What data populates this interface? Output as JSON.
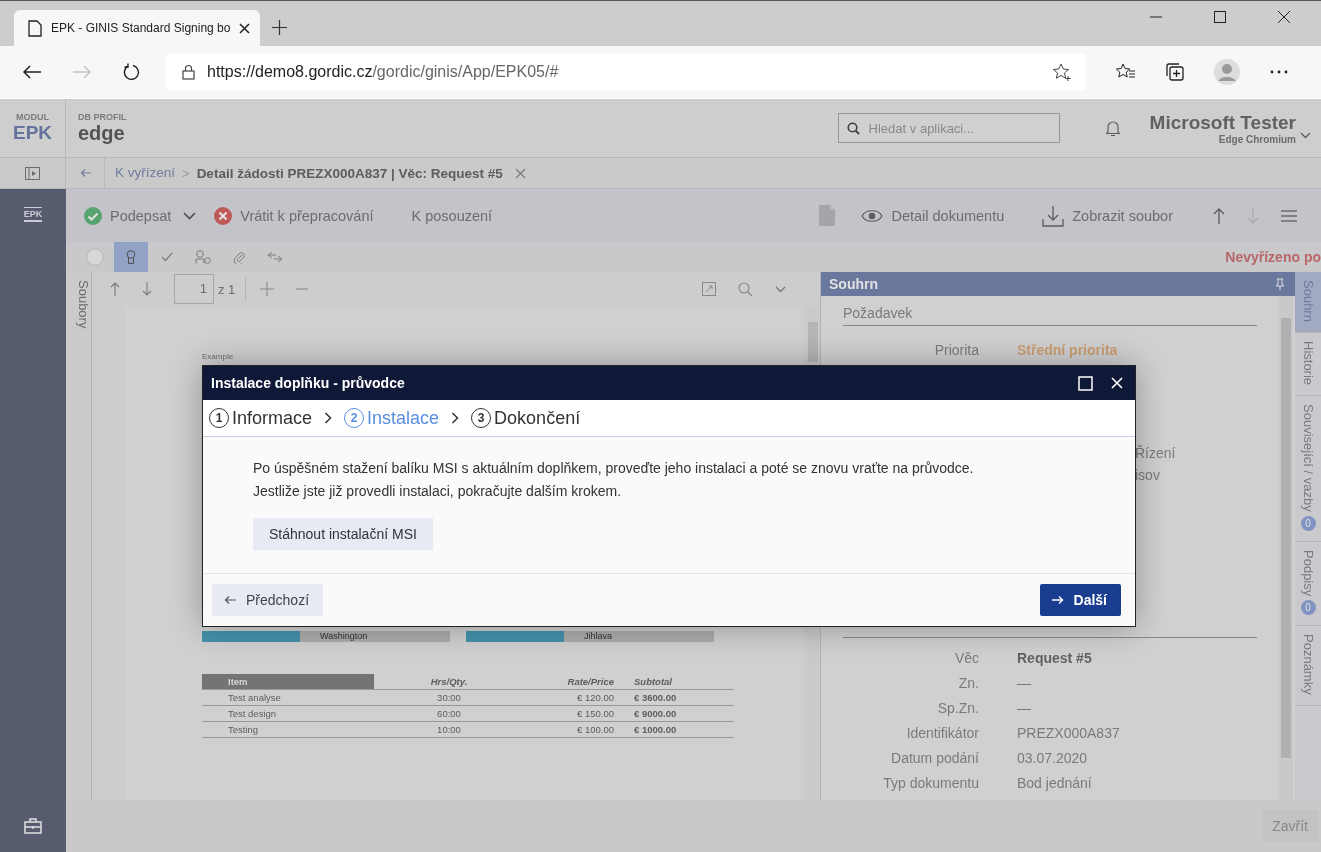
{
  "browser": {
    "tab_title": "EPK - GINIS Standard Signing bo",
    "url_host": "https://demo8.gordic.cz",
    "url_path": "/gordic/ginis/App/EPK05/#",
    "nav": [
      {
        "kind": "back",
        "disabled": false
      },
      {
        "kind": "forward",
        "disabled": true
      },
      {
        "kind": "refresh",
        "disabled": false
      }
    ]
  },
  "header": {
    "module_label": "MODUL",
    "module": "EPK",
    "profile_label": "DB PROFIL",
    "profile": "edge",
    "search": {
      "placeholder": "Hledat v aplikaci..."
    },
    "user_name": "Microsoft Tester",
    "user_sub": "Edge Chromium"
  },
  "breadcrumb": {
    "separator": ">",
    "items": [
      {
        "label": "K vyřízení",
        "kind": "link"
      },
      {
        "label": "Detail žádosti PREZX000A837 | Věc: Request #5",
        "kind": "current"
      }
    ]
  },
  "sidebar": {
    "logo": "EPK"
  },
  "toolbar": {
    "actions": [
      {
        "label": "Podepsat",
        "kind": "sign"
      },
      {
        "label": "Vrátit k přepracování",
        "kind": "return"
      },
      {
        "label": "K posouzení",
        "kind": "plain"
      }
    ],
    "right_actions": [
      {
        "label": "Detail dokumentu",
        "kind": "view"
      },
      {
        "label": "Zobrazit soubor",
        "kind": "download"
      }
    ],
    "nav": [
      {
        "kind": "up",
        "disabled": false
      },
      {
        "kind": "down",
        "disabled": true
      }
    ]
  },
  "filters": [
    {
      "kind": "circle",
      "selected": false
    },
    {
      "kind": "ribbon",
      "selected": true
    },
    {
      "kind": "check",
      "selected": false
    },
    {
      "kind": "person",
      "selected": false
    },
    {
      "kind": "clip",
      "selected": false
    },
    {
      "kind": "arrows",
      "selected": false
    }
  ],
  "status": "Nevyřízeno po",
  "files_tab": "Soubory",
  "viewer": {
    "page": "1",
    "page_count": "z 1",
    "document": {
      "heading": "Example",
      "address": [
        "Washington",
        "Jihlava"
      ],
      "columns": [
        "Item",
        "Hrs/Qty.",
        "Rate/Price",
        "Subtotal"
      ],
      "rows": [
        [
          "Test analyse",
          "30:00",
          "€ 120.00",
          "€ 3600.00"
        ],
        [
          "Test design",
          "60:00",
          "€ 150.00",
          "€ 9000.00"
        ],
        [
          "Testing",
          "10:00",
          "€ 100.00",
          "€ 1000.00"
        ]
      ]
    }
  },
  "summary": {
    "title": "Souhrn",
    "section": "Požadavek",
    "priority": {
      "label": "Priorita",
      "value": "Střední priorita"
    },
    "partial_values": [
      "Řízení",
      "isov"
    ],
    "fields": [
      {
        "label": "Věc",
        "value": "Request #5",
        "kind": "bold"
      },
      {
        "label": "Zn.",
        "value": "—",
        "kind": "plain"
      },
      {
        "label": "Sp.Zn.",
        "value": "—",
        "kind": "plain"
      },
      {
        "label": "Identifikátor",
        "value": "PREZX000A837",
        "kind": "plain"
      },
      {
        "label": "Datum podání",
        "value": "03.07.2020",
        "kind": "plain"
      },
      {
        "label": "Typ dokumentu",
        "value": "Bod jednání",
        "kind": "plain"
      }
    ]
  },
  "side_tabs": [
    {
      "label": "Souhrn",
      "selected": true
    },
    {
      "label": "Historie",
      "selected": false
    },
    {
      "label": "Související / vazby",
      "badge": "0",
      "selected": false
    },
    {
      "label": "Podpisy",
      "badge": "0",
      "selected": false
    },
    {
      "label": "Poznámky",
      "selected": false
    }
  ],
  "footer": {
    "close_button": "Zavřít"
  },
  "wizard": {
    "title": "Instalace doplňku - průvodce",
    "steps": [
      {
        "number": "1",
        "label": "Informace",
        "selected": false
      },
      {
        "number": "2",
        "label": "Instalace",
        "selected": true
      },
      {
        "number": "3",
        "label": "Dokončení",
        "selected": false
      }
    ],
    "message": [
      "Po úspěšném stažení balíku MSI s aktuálním doplňkem, proveďte jeho instalaci a poté se znovu vraťte na průvodce.",
      "Jestliže jste již provedli instalaci, pokračujte dalším krokem."
    ],
    "download_button": "Stáhnout instalační MSI",
    "back_button": "Předchozí",
    "next_button": "Další"
  }
}
